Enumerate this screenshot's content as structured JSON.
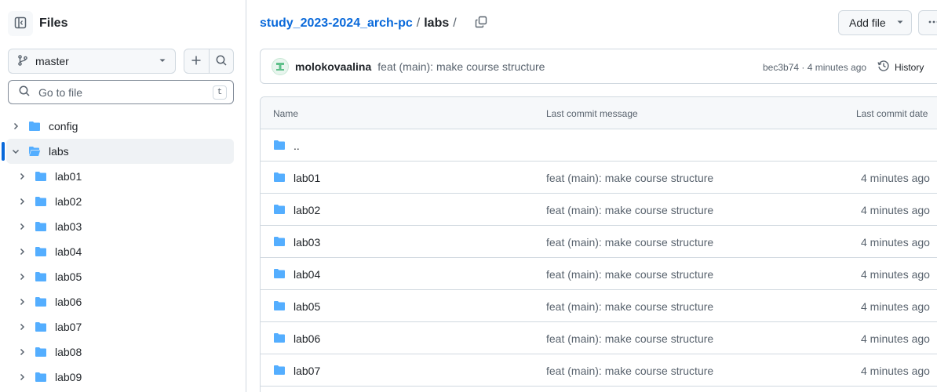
{
  "sidebar": {
    "title": "Files",
    "branch": "master",
    "search_placeholder": "Go to file",
    "search_shortcut": "t",
    "tree": [
      {
        "label": "config",
        "depth": 1,
        "expanded": false,
        "selected": false
      },
      {
        "label": "labs",
        "depth": 1,
        "expanded": true,
        "selected": true
      },
      {
        "label": "lab01",
        "depth": 2,
        "expanded": false,
        "selected": false
      },
      {
        "label": "lab02",
        "depth": 2,
        "expanded": false,
        "selected": false
      },
      {
        "label": "lab03",
        "depth": 2,
        "expanded": false,
        "selected": false
      },
      {
        "label": "lab04",
        "depth": 2,
        "expanded": false,
        "selected": false
      },
      {
        "label": "lab05",
        "depth": 2,
        "expanded": false,
        "selected": false
      },
      {
        "label": "lab06",
        "depth": 2,
        "expanded": false,
        "selected": false
      },
      {
        "label": "lab07",
        "depth": 2,
        "expanded": false,
        "selected": false
      },
      {
        "label": "lab08",
        "depth": 2,
        "expanded": false,
        "selected": false
      },
      {
        "label": "lab09",
        "depth": 2,
        "expanded": false,
        "selected": false
      }
    ]
  },
  "breadcrumb": {
    "repo": "study_2023-2024_arch-pc",
    "sep1": "/",
    "current": "labs",
    "sep2": "/"
  },
  "toolbar": {
    "add_file_label": "Add file"
  },
  "commit": {
    "author": "molokovaalina",
    "message": "feat (main): make course structure",
    "sha_time": "bec3b74 · 4 minutes ago",
    "history_label": "History"
  },
  "table": {
    "headers": {
      "name": "Name",
      "message": "Last commit message",
      "date": "Last commit date"
    },
    "parent": "..",
    "rows": [
      {
        "name": "lab01",
        "message": "feat (main): make course structure",
        "date": "4 minutes ago"
      },
      {
        "name": "lab02",
        "message": "feat (main): make course structure",
        "date": "4 minutes ago"
      },
      {
        "name": "lab03",
        "message": "feat (main): make course structure",
        "date": "4 minutes ago"
      },
      {
        "name": "lab04",
        "message": "feat (main): make course structure",
        "date": "4 minutes ago"
      },
      {
        "name": "lab05",
        "message": "feat (main): make course structure",
        "date": "4 minutes ago"
      },
      {
        "name": "lab06",
        "message": "feat (main): make course structure",
        "date": "4 minutes ago"
      },
      {
        "name": "lab07",
        "message": "feat (main): make course structure",
        "date": "4 minutes ago"
      }
    ]
  },
  "colors": {
    "link": "#0969da",
    "folder": "#54aeff",
    "border": "#d1d9e0",
    "muted_text": "#59636e"
  },
  "icons": [
    "sidebar-collapse-icon",
    "git-branch-icon",
    "plus-icon",
    "search-icon",
    "folder-icon",
    "folder-open-icon",
    "chevron-right-icon",
    "chevron-down-icon",
    "copy-icon",
    "kebab-horizontal-icon",
    "history-icon",
    "triangle-down-icon"
  ]
}
